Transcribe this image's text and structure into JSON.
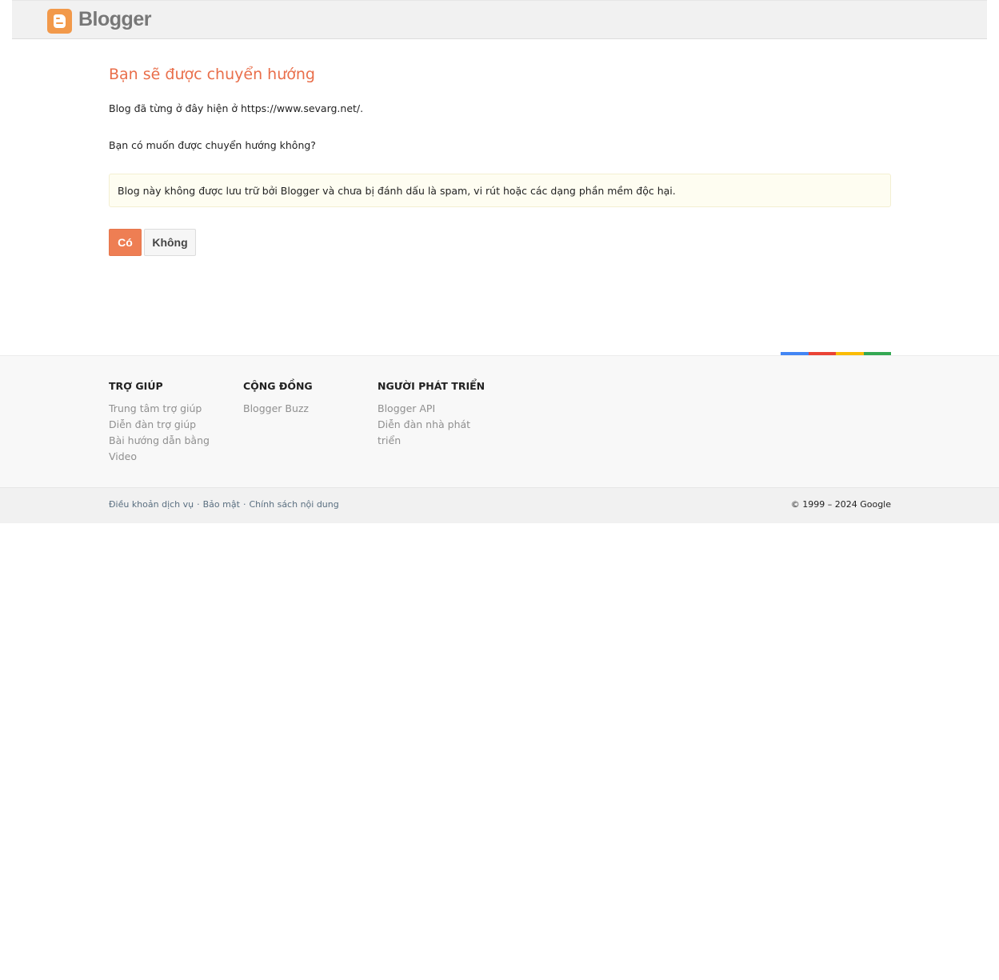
{
  "header": {
    "logo_text": "Blogger"
  },
  "main": {
    "title": "Bạn sẽ được chuyển hướng",
    "moved_text": "Blog đã từng ở đây hiện ở https://www.sevarg.net/.",
    "question": "Bạn có muốn được chuyển hướng không?",
    "notice": "Blog này không được lưu trữ bởi Blogger và chưa bị đánh dấu là spam, vi rút hoặc các dạng phần mềm độc hại.",
    "yes_label": "Có",
    "no_label": "Không"
  },
  "colors": {
    "accent": "#e96e4a",
    "button": "#ee7e53",
    "google_bar": [
      "#4285f4",
      "#ea4335",
      "#fbbc05",
      "#34a853"
    ]
  },
  "footer": {
    "columns": [
      {
        "heading": "TRỢ GIÚP",
        "links": [
          "Trung tâm trợ giúp",
          "Diễn đàn trợ giúp",
          "Bài hướng dẫn bằng Video"
        ]
      },
      {
        "heading": "CỘNG ĐỒNG",
        "links": [
          "Blogger Buzz"
        ]
      },
      {
        "heading": "NGƯỜI PHÁT TRIỂN",
        "links": [
          "Blogger API",
          "Diễn đàn nhà phát triển"
        ]
      }
    ]
  },
  "subfooter": {
    "links": [
      "Điều khoản dịch vụ",
      "Bảo mật",
      "Chính sách nội dung"
    ],
    "separator": "·",
    "copyright": "© 1999 – 2024 Google"
  }
}
